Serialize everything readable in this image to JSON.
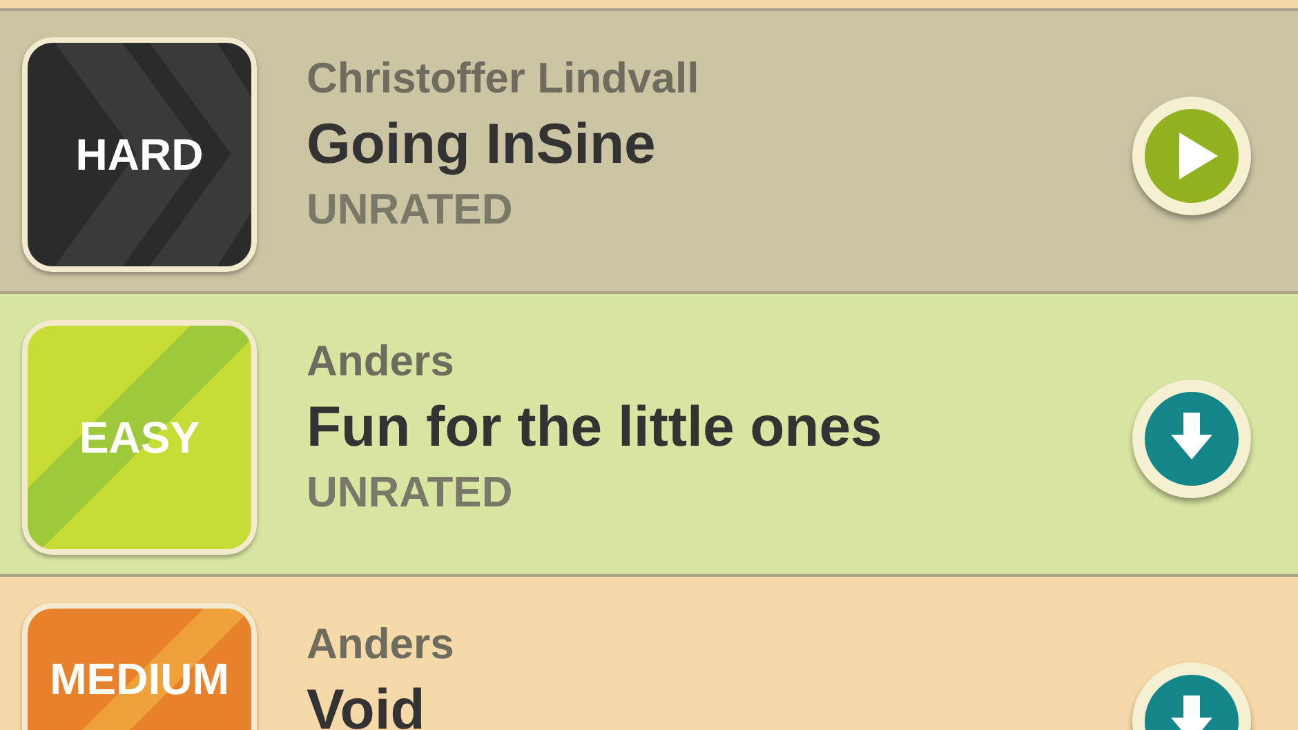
{
  "levels": [
    {
      "author": "Christoffer Lindvall",
      "title": "Going InSine",
      "rating": "UNRATED",
      "difficulty": {
        "label": "HARD",
        "kind": "hard"
      },
      "button": {
        "kind": "play"
      },
      "color": "#cbc5a4"
    },
    {
      "author": "Anders",
      "title": "Fun for the little ones",
      "rating": "UNRATED",
      "difficulty": {
        "label": "EASY",
        "kind": "easy"
      },
      "button": {
        "kind": "download"
      },
      "color": "#d9e6a2"
    },
    {
      "author": "Anders",
      "title": "Void",
      "difficulty": {
        "label": "MEDIUM",
        "kind": "medium"
      },
      "button": {
        "kind": "download"
      },
      "color": "#f6d9a8"
    }
  ]
}
